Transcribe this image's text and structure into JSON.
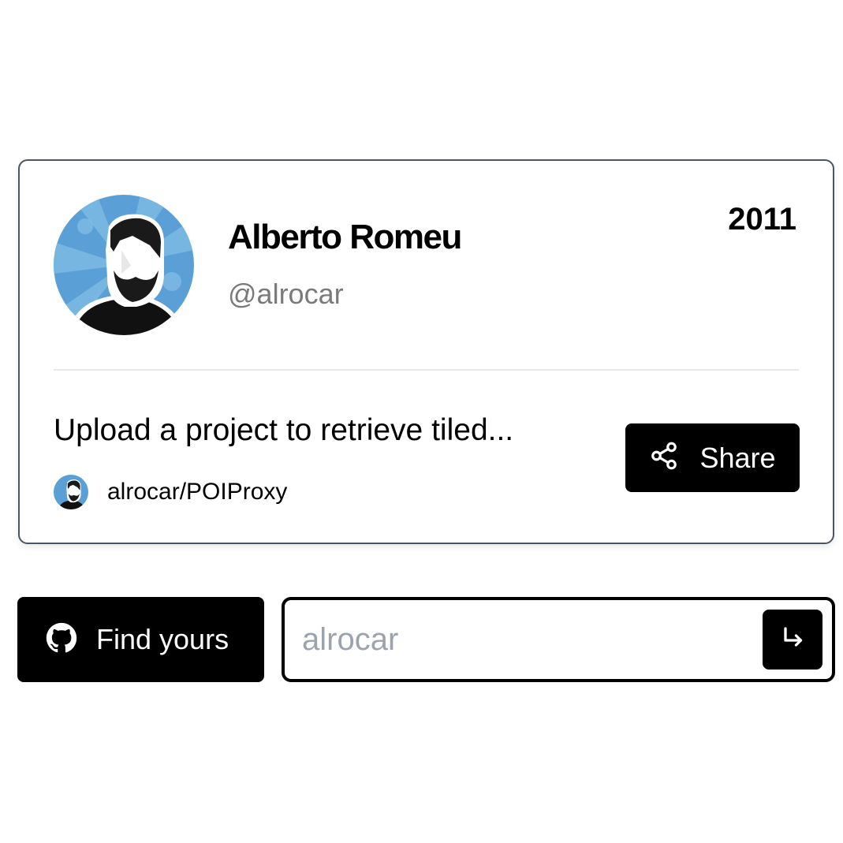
{
  "profile": {
    "name": "Alberto Romeu",
    "handle": "@alrocar",
    "year": "2011",
    "avatar_bg": "#5aa0d6"
  },
  "project": {
    "description": "Upload a project to retrieve tiled...",
    "repo": "alrocar/POIProxy"
  },
  "actions": {
    "share_label": "Share",
    "find_label": "Find yours"
  },
  "search": {
    "placeholder": "alrocar",
    "value": ""
  },
  "icons": {
    "share": "share-icon",
    "github": "github-icon",
    "submit": "arrow-return-icon"
  }
}
